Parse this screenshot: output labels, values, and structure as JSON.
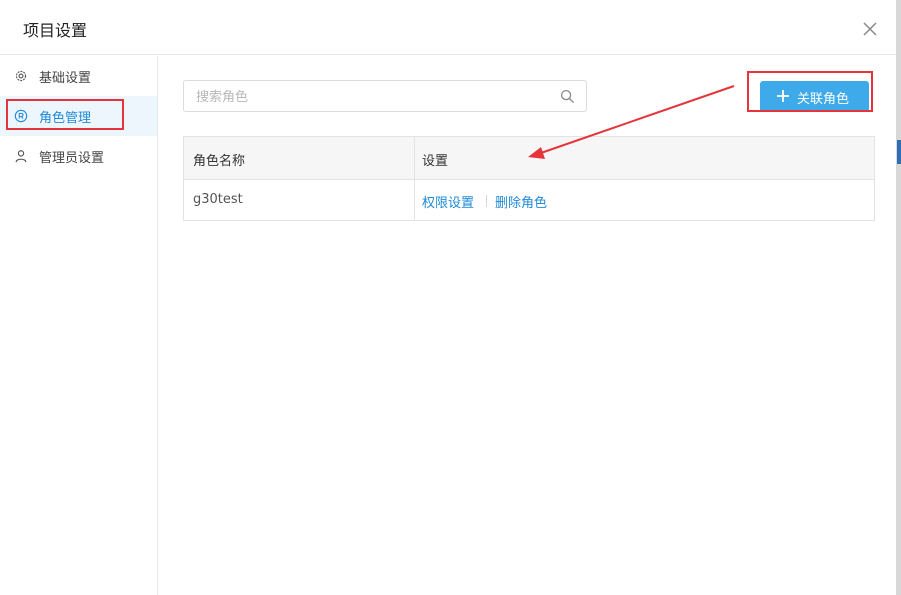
{
  "dialog": {
    "title": "项目设置"
  },
  "sidebar": {
    "items": [
      {
        "label": "基础设置",
        "icon": "gear-icon",
        "active": false
      },
      {
        "label": "角色管理",
        "icon": "registered-icon",
        "active": true
      },
      {
        "label": "管理员设置",
        "icon": "user-icon",
        "active": false
      }
    ]
  },
  "toolbar": {
    "search_placeholder": "搜索角色",
    "search_value": "",
    "add_label": "关联角色"
  },
  "table": {
    "headers": [
      "角色名称",
      "设置"
    ],
    "rows": [
      {
        "name": "g30test",
        "actions": [
          "权限设置",
          "删除角色"
        ]
      }
    ]
  },
  "colors": {
    "accent": "#3eaaea",
    "link": "#1f8ad8",
    "annotation": "#e5353a",
    "active_bg": "#eef6fd"
  }
}
